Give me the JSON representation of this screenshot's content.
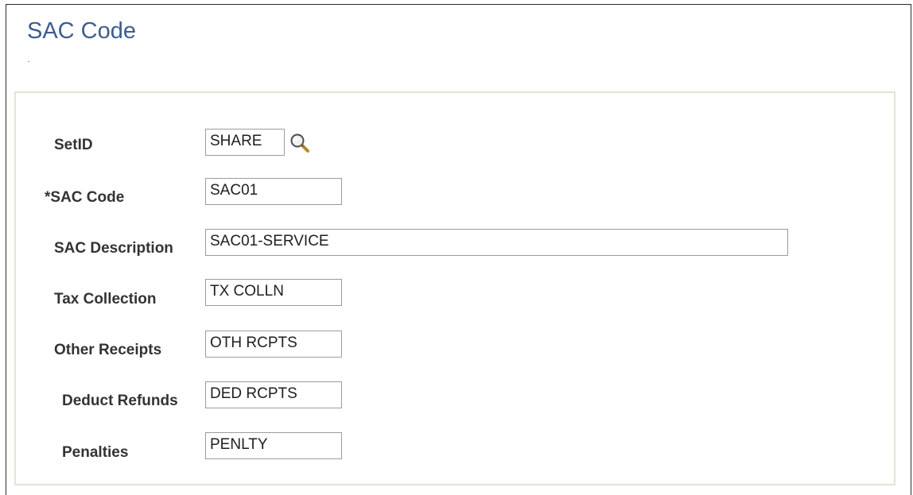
{
  "page": {
    "title": "SAC Code"
  },
  "form": {
    "setid": {
      "label": "SetID",
      "value": "SHARE"
    },
    "sac_code": {
      "label": "*SAC Code",
      "value": "SAC01"
    },
    "sac_description": {
      "label": "SAC Description",
      "value": "SAC01-SERVICE"
    },
    "tax_collection": {
      "label": "Tax Collection",
      "value": "TX COLLN"
    },
    "other_receipts": {
      "label": "Other Receipts",
      "value": "OTH RCPTS"
    },
    "deduct_refunds": {
      "label": "Deduct Refunds",
      "value": "DED RCPTS"
    },
    "penalties": {
      "label": "Penalties",
      "value": "PENLTY"
    }
  },
  "icons": {
    "setid_lookup": "magnifying-glass-icon"
  },
  "colors": {
    "title": "#3d5d8f",
    "group_border": "#e6e3d6",
    "input_border": "#9c9c9c"
  }
}
